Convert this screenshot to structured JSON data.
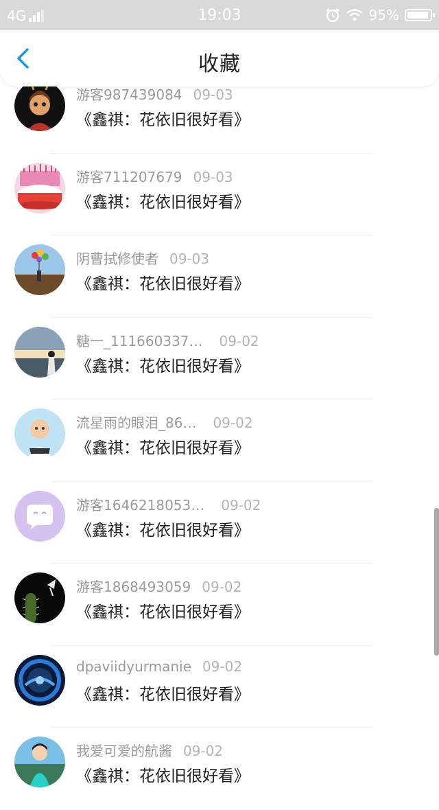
{
  "status": {
    "network": "4G",
    "time": "19:03",
    "battery": "95%",
    "battery_level": 0.95
  },
  "header": {
    "title": "收藏"
  },
  "items": [
    {
      "user": "游客987439084",
      "date": "09-03",
      "text": "《鑫祺：花依旧很好看》"
    },
    {
      "user": "游客711207679",
      "date": "09-03",
      "text": "《鑫祺：花依旧很好看》"
    },
    {
      "user": "阴曹拭修使者",
      "date": "09-03",
      "text": "《鑫祺：花依旧很好看》"
    },
    {
      "user": "糖一_111660337…",
      "date": "09-02",
      "text": "《鑫祺：花依旧很好看》"
    },
    {
      "user": "流星雨的眼泪_86…",
      "date": "09-02",
      "text": "《鑫祺：花依旧很好看》"
    },
    {
      "user": "游客1646218053…",
      "date": "09-02",
      "text": "《鑫祺：花依旧很好看》"
    },
    {
      "user": "游客1868493059",
      "date": "09-02",
      "text": "《鑫祺：花依旧很好看》"
    },
    {
      "user": "dpaviidyurmanie",
      "date": "09-02",
      "text": "《鑫祺：花依旧很好看》"
    },
    {
      "user": "我爱可爱的航酱",
      "date": "09-02",
      "text": "《鑫祺：花依旧很好看》"
    }
  ]
}
